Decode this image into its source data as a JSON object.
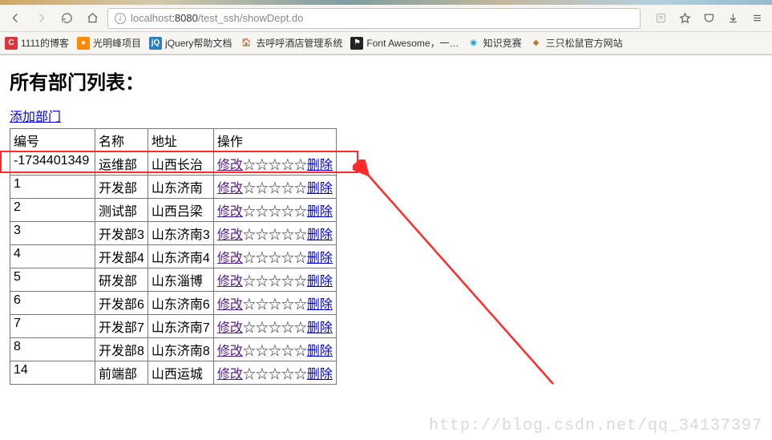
{
  "url": {
    "prefix": "localhost",
    "port": ":8080",
    "path": "/test_ssh/showDept.do"
  },
  "bookmarks": {
    "b1": "1111的博客",
    "b2": "光明峰项目",
    "b3": "jQuery帮助文档",
    "b4": "去呼呼酒店管理系统",
    "b5": "Font Awesome，一…",
    "b6": "知识竞赛",
    "b7": "三只松鼠官方网站"
  },
  "page": {
    "title": "所有部门列表：",
    "add_link": "添加部门"
  },
  "table": {
    "h_id": "编号",
    "h_name": "名称",
    "h_addr": "地址",
    "h_op": "操作",
    "modify": "修改",
    "delete": "删除",
    "stars": "☆☆☆☆☆",
    "rows": {
      "r0": {
        "id": "-1734401349",
        "name": "运维部",
        "addr": "山西长治"
      },
      "r1": {
        "id": "1",
        "name": "开发部",
        "addr": "山东济南"
      },
      "r2": {
        "id": "2",
        "name": "测试部",
        "addr": "山西吕梁"
      },
      "r3": {
        "id": "3",
        "name": "开发部3",
        "addr": "山东济南3"
      },
      "r4": {
        "id": "4",
        "name": "开发部4",
        "addr": "山东济南4"
      },
      "r5": {
        "id": "5",
        "name": "研发部",
        "addr": "山东淄博"
      },
      "r6": {
        "id": "6",
        "name": "开发部6",
        "addr": "山东济南6"
      },
      "r7": {
        "id": "7",
        "name": "开发部7",
        "addr": "山东济南7"
      },
      "r8": {
        "id": "8",
        "name": "开发部8",
        "addr": "山东济南8"
      },
      "r9": {
        "id": "14",
        "name": "前端部",
        "addr": "山西运城"
      }
    }
  },
  "watermark": "http://blog.csdn.net/qq_34137397"
}
